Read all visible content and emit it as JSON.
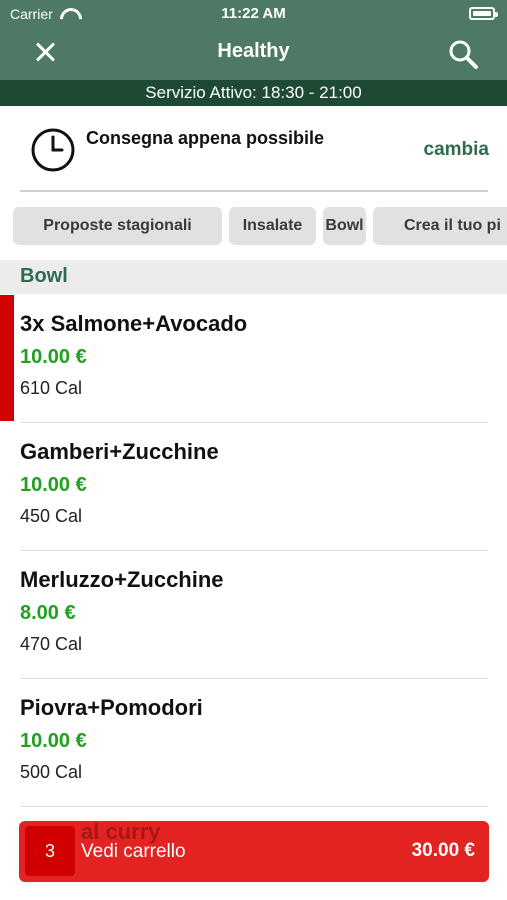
{
  "status_bar": {
    "carrier": "Carrier",
    "time": "11:22 AM"
  },
  "nav": {
    "title": "Healthy",
    "close_icon": "close-icon",
    "search_icon": "search-icon"
  },
  "service_banner": "Servizio Attivo: 18:30 - 21:00",
  "delivery": {
    "label": "Consegna appena possibile",
    "change_label": "cambia"
  },
  "categories": [
    "Proposte stagionali",
    "Insalate",
    "Bowl",
    "Crea il tuo pi"
  ],
  "section_title": "Bowl",
  "items": [
    {
      "name": "3x Salmone+Avocado",
      "price": "10.00 €",
      "cal": "610 Cal",
      "selected": true
    },
    {
      "name": "Gamberi+Zucchine",
      "price": "10.00 €",
      "cal": "450 Cal",
      "selected": false
    },
    {
      "name": "Merluzzo+Zucchine",
      "price": "8.00 €",
      "cal": "470 Cal",
      "selected": false
    },
    {
      "name": "Piovra+Pomodori",
      "price": "10.00 €",
      "cal": "500 Cal",
      "selected": false
    }
  ],
  "next_item_partial": "al curry",
  "cart": {
    "count": "3",
    "label": "Vedi carrello",
    "total": "30.00 €"
  },
  "colors": {
    "header": "#4e7a65",
    "service": "#1e4a34",
    "price": "#1fa21f",
    "accent": "#d40000",
    "cart": "#e32222"
  }
}
